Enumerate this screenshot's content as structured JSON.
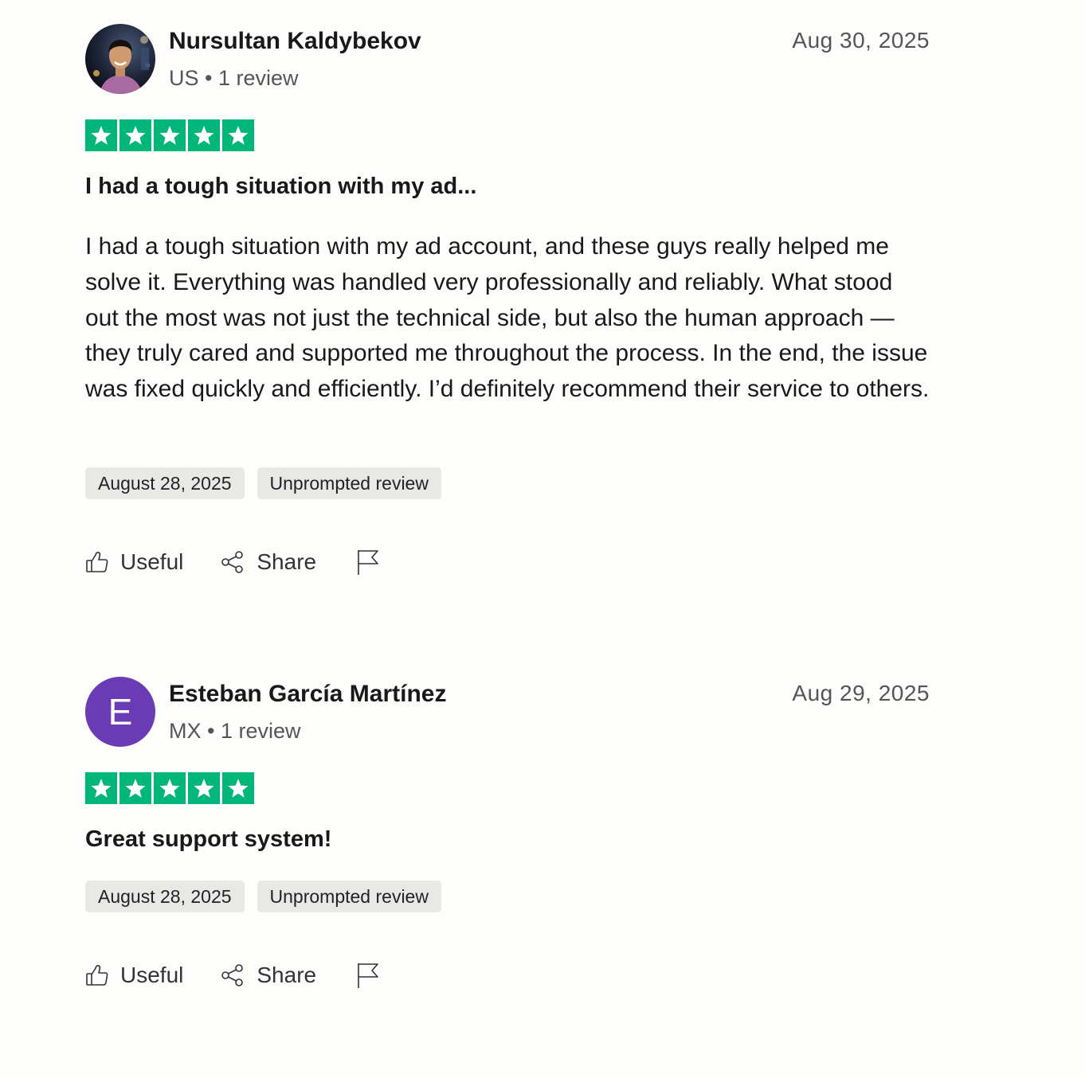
{
  "reviews": [
    {
      "reviewer_name": "Nursultan Kaldybekov",
      "reviewer_meta": "US • 1 review",
      "date": "Aug 30, 2025",
      "rating": 5,
      "title": "I had a tough situation with my ad...",
      "body": "I had a tough situation with my ad account, and these guys really helped me solve it. Everything was handled very professionally and reliably. What stood out the most was not just the technical side, but also the human approach — they truly cared and supported me throughout the process. In the end, the issue was fixed quickly and efficiently. I’d definitely recommend their service to others.",
      "experience_date": "August 28, 2025",
      "review_type": "Unprompted review",
      "useful_label": "Useful",
      "share_label": "Share",
      "avatar_type": "photo"
    },
    {
      "reviewer_name": "Esteban García Martínez",
      "reviewer_meta": "MX • 1 review",
      "date": "Aug 29, 2025",
      "rating": 5,
      "title": "Great support system!",
      "experience_date": "August 28, 2025",
      "review_type": "Unprompted review",
      "useful_label": "Useful",
      "share_label": "Share",
      "avatar_letter": "E",
      "avatar_color": "#6a3bb5"
    }
  ],
  "colors": {
    "star_green": "#00b67a",
    "tag_background": "#e8e8e6",
    "text_primary": "#191919",
    "text_secondary": "#555555"
  },
  "icons": [
    "thumbs-up-icon",
    "share-icon",
    "flag-icon",
    "star-icon"
  ]
}
